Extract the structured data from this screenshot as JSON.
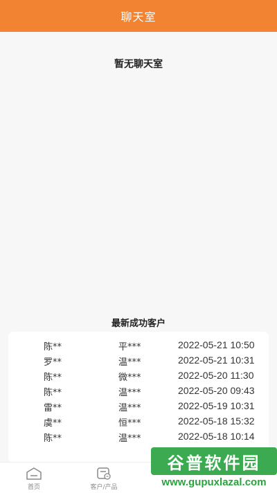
{
  "header": {
    "title": "聊天室"
  },
  "chat_room": {
    "empty_message": "暂无聊天室"
  },
  "recent_customers": {
    "title": "最新成功客户",
    "rows": [
      {
        "name": "陈**",
        "product": "平***",
        "time": "2022-05-21 10:50"
      },
      {
        "name": "罗**",
        "product": "温***",
        "time": "2022-05-21 10:31"
      },
      {
        "name": "陈**",
        "product": "微***",
        "time": "2022-05-20 11:30"
      },
      {
        "name": "陈**",
        "product": "温***",
        "time": "2022-05-20 09:43"
      },
      {
        "name": "雷**",
        "product": "温***",
        "time": "2022-05-19 10:31"
      },
      {
        "name": "虞**",
        "product": "恒***",
        "time": "2022-05-18 15:32"
      },
      {
        "name": "陈**",
        "product": "温***",
        "time": "2022-05-18 10:14"
      }
    ]
  },
  "tabbar": {
    "tabs": [
      {
        "label": "首页",
        "icon": "home-icon"
      },
      {
        "label": "客户/产品",
        "icon": "customer-card-icon"
      }
    ]
  },
  "watermark": {
    "brand": "谷普软件园",
    "url": "www.gupuxlazal.com"
  },
  "colors": {
    "header": "#f18332",
    "watermark": "#2ba341"
  }
}
